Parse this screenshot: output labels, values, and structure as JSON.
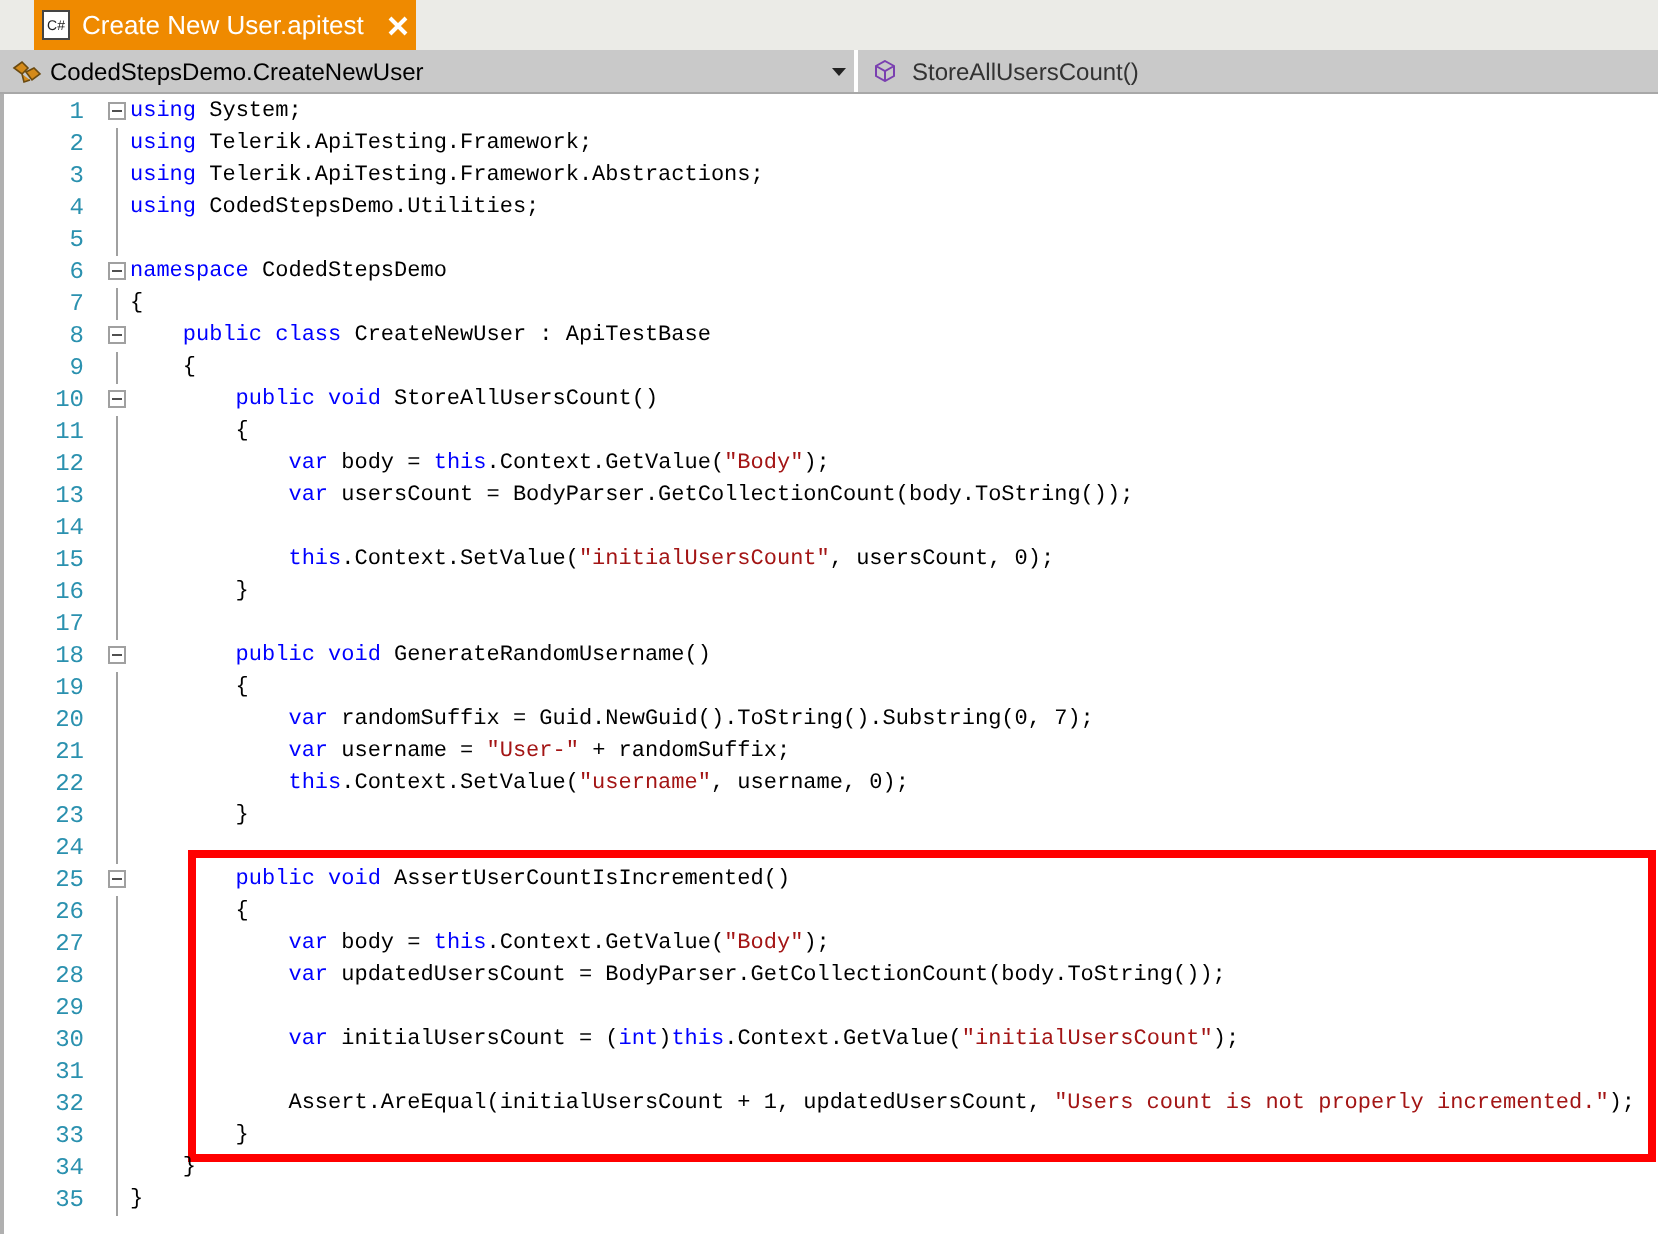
{
  "tab": {
    "icon_label": "C#",
    "title": "Create New User.apitest",
    "selected": true
  },
  "navigation": {
    "type_dropdown": "CodedStepsDemo.CreateNewUser",
    "member_dropdown": "StoreAllUsersCount()"
  },
  "lines": [
    {
      "number": "1",
      "collapsible": true,
      "highlighted": false,
      "tokens": [
        {
          "kind": "keyword",
          "text": "using"
        },
        {
          "kind": "plain",
          "text": " System;"
        }
      ]
    },
    {
      "number": "2",
      "collapsible": false,
      "highlighted": false,
      "tokens": [
        {
          "kind": "keyword",
          "text": "using"
        },
        {
          "kind": "plain",
          "text": " Telerik.ApiTesting.Framework;"
        }
      ]
    },
    {
      "number": "3",
      "collapsible": false,
      "highlighted": false,
      "tokens": [
        {
          "kind": "keyword",
          "text": "using"
        },
        {
          "kind": "plain",
          "text": " Telerik.ApiTesting.Framework.Abstractions;"
        }
      ]
    },
    {
      "number": "4",
      "collapsible": false,
      "highlighted": false,
      "tokens": [
        {
          "kind": "keyword",
          "text": "using"
        },
        {
          "kind": "plain",
          "text": " CodedStepsDemo.Utilities;"
        }
      ]
    },
    {
      "number": "5",
      "collapsible": false,
      "highlighted": false
    },
    {
      "number": "6",
      "collapsible": true,
      "highlighted": false,
      "tokens": [
        {
          "kind": "keyword",
          "text": "namespace"
        },
        {
          "kind": "plain",
          "text": " CodedStepsDemo"
        }
      ]
    },
    {
      "number": "7",
      "collapsible": false,
      "highlighted": false,
      "tokens": [
        {
          "kind": "plain",
          "text": "{"
        }
      ]
    },
    {
      "number": "8",
      "collapsible": true,
      "highlighted": false,
      "tokens": [
        {
          "kind": "keyword",
          "text": "    public class"
        },
        {
          "kind": "plain",
          "text": " CreateNewUser : ApiTestBase"
        }
      ]
    },
    {
      "number": "9",
      "collapsible": false,
      "highlighted": false,
      "tokens": [
        {
          "kind": "plain",
          "text": "    {"
        }
      ]
    },
    {
      "number": "10",
      "collapsible": true,
      "highlighted": false,
      "tokens": [
        {
          "kind": "keyword",
          "text": "        public void"
        },
        {
          "kind": "plain",
          "text": " StoreAllUsersCount()"
        }
      ]
    },
    {
      "number": "11",
      "collapsible": false,
      "highlighted": false,
      "tokens": [
        {
          "kind": "plain",
          "text": "        {"
        }
      ]
    },
    {
      "number": "12",
      "collapsible": false,
      "highlighted": false,
      "tokens": [
        {
          "kind": "keyword",
          "text": "            var"
        },
        {
          "kind": "plain",
          "text": " body = "
        },
        {
          "kind": "keyword",
          "text": "this"
        },
        {
          "kind": "plain",
          "text": ".Context.GetValue("
        },
        {
          "kind": "string",
          "text": "\"Body\""
        },
        {
          "kind": "plain",
          "text": ");"
        }
      ]
    },
    {
      "number": "13",
      "collapsible": false,
      "highlighted": false,
      "tokens": [
        {
          "kind": "keyword",
          "text": "            var"
        },
        {
          "kind": "plain",
          "text": " usersCount = BodyParser.GetCollectionCount(body.ToString());"
        }
      ]
    },
    {
      "number": "14",
      "collapsible": false,
      "highlighted": false
    },
    {
      "number": "15",
      "collapsible": false,
      "highlighted": false,
      "tokens": [
        {
          "kind": "keyword",
          "text": "            this"
        },
        {
          "kind": "plain",
          "text": ".Context.SetValue("
        },
        {
          "kind": "string",
          "text": "\"initialUsersCount\""
        },
        {
          "kind": "plain",
          "text": ", usersCount, 0);"
        }
      ]
    },
    {
      "number": "16",
      "collapsible": false,
      "highlighted": false,
      "tokens": [
        {
          "kind": "plain",
          "text": "        }"
        }
      ]
    },
    {
      "number": "17",
      "collapsible": false,
      "highlighted": false
    },
    {
      "number": "18",
      "collapsible": true,
      "highlighted": false,
      "tokens": [
        {
          "kind": "keyword",
          "text": "        public void"
        },
        {
          "kind": "plain",
          "text": " GenerateRandomUsername()"
        }
      ]
    },
    {
      "number": "19",
      "collapsible": false,
      "highlighted": false,
      "tokens": [
        {
          "kind": "plain",
          "text": "        {"
        }
      ]
    },
    {
      "number": "20",
      "collapsible": false,
      "highlighted": false,
      "tokens": [
        {
          "kind": "keyword",
          "text": "            var"
        },
        {
          "kind": "plain",
          "text": " randomSuffix = Guid.NewGuid().ToString().Substring(0, 7);"
        }
      ]
    },
    {
      "number": "21",
      "collapsible": false,
      "highlighted": false,
      "tokens": [
        {
          "kind": "keyword",
          "text": "            var"
        },
        {
          "kind": "plain",
          "text": " username = "
        },
        {
          "kind": "string",
          "text": "\"User-\""
        },
        {
          "kind": "plain",
          "text": " + randomSuffix;"
        }
      ]
    },
    {
      "number": "22",
      "collapsible": false,
      "highlighted": false,
      "tokens": [
        {
          "kind": "keyword",
          "text": "            this"
        },
        {
          "kind": "plain",
          "text": ".Context.SetValue("
        },
        {
          "kind": "string",
          "text": "\"username\""
        },
        {
          "kind": "plain",
          "text": ", username, 0);"
        }
      ]
    },
    {
      "number": "23",
      "collapsible": false,
      "highlighted": false,
      "tokens": [
        {
          "kind": "plain",
          "text": "        }"
        }
      ]
    },
    {
      "number": "24",
      "collapsible": false,
      "highlighted": false
    },
    {
      "number": "25",
      "collapsible": true,
      "highlighted": true,
      "tokens": [
        {
          "kind": "keyword",
          "text": "        public void"
        },
        {
          "kind": "plain",
          "text": " AssertUserCountIsIncremented()"
        }
      ]
    },
    {
      "number": "26",
      "collapsible": false,
      "highlighted": true,
      "tokens": [
        {
          "kind": "plain",
          "text": "        {"
        }
      ]
    },
    {
      "number": "27",
      "collapsible": false,
      "highlighted": true,
      "tokens": [
        {
          "kind": "keyword",
          "text": "            var"
        },
        {
          "kind": "plain",
          "text": " body = "
        },
        {
          "kind": "keyword",
          "text": "this"
        },
        {
          "kind": "plain",
          "text": ".Context.GetValue("
        },
        {
          "kind": "string",
          "text": "\"Body\""
        },
        {
          "kind": "plain",
          "text": ");"
        }
      ]
    },
    {
      "number": "28",
      "collapsible": false,
      "highlighted": true,
      "tokens": [
        {
          "kind": "keyword",
          "text": "            var"
        },
        {
          "kind": "plain",
          "text": " updatedUsersCount = BodyParser.GetCollectionCount(body.ToString());"
        }
      ]
    },
    {
      "number": "29",
      "collapsible": false,
      "highlighted": true
    },
    {
      "number": "30",
      "collapsible": false,
      "highlighted": true,
      "tokens": [
        {
          "kind": "keyword",
          "text": "            var"
        },
        {
          "kind": "plain",
          "text": " initialUsersCount = ("
        },
        {
          "kind": "keyword",
          "text": "int"
        },
        {
          "kind": "plain",
          "text": ")"
        },
        {
          "kind": "keyword",
          "text": "this"
        },
        {
          "kind": "plain",
          "text": ".Context.GetValue("
        },
        {
          "kind": "string",
          "text": "\"initialUsersCount\""
        },
        {
          "kind": "plain",
          "text": ");"
        }
      ]
    },
    {
      "number": "31",
      "collapsible": false,
      "highlighted": true
    },
    {
      "number": "32",
      "collapsible": false,
      "highlighted": true,
      "tokens": [
        {
          "kind": "plain",
          "text": "            Assert.AreEqual(initialUsersCount + 1, updatedUsersCount, "
        },
        {
          "kind": "string",
          "text": "\"Users count is not properly incremented.\""
        },
        {
          "kind": "plain",
          "text": ");"
        }
      ]
    },
    {
      "number": "33",
      "collapsible": false,
      "highlighted": true,
      "tokens": [
        {
          "kind": "plain",
          "text": "        }"
        }
      ]
    },
    {
      "number": "34",
      "collapsible": false,
      "highlighted": false,
      "tokens": [
        {
          "kind": "plain",
          "text": "    }"
        }
      ]
    },
    {
      "number": "35",
      "collapsible": false,
      "highlighted": false,
      "tokens": [
        {
          "kind": "plain",
          "text": "}"
        }
      ]
    }
  ]
}
